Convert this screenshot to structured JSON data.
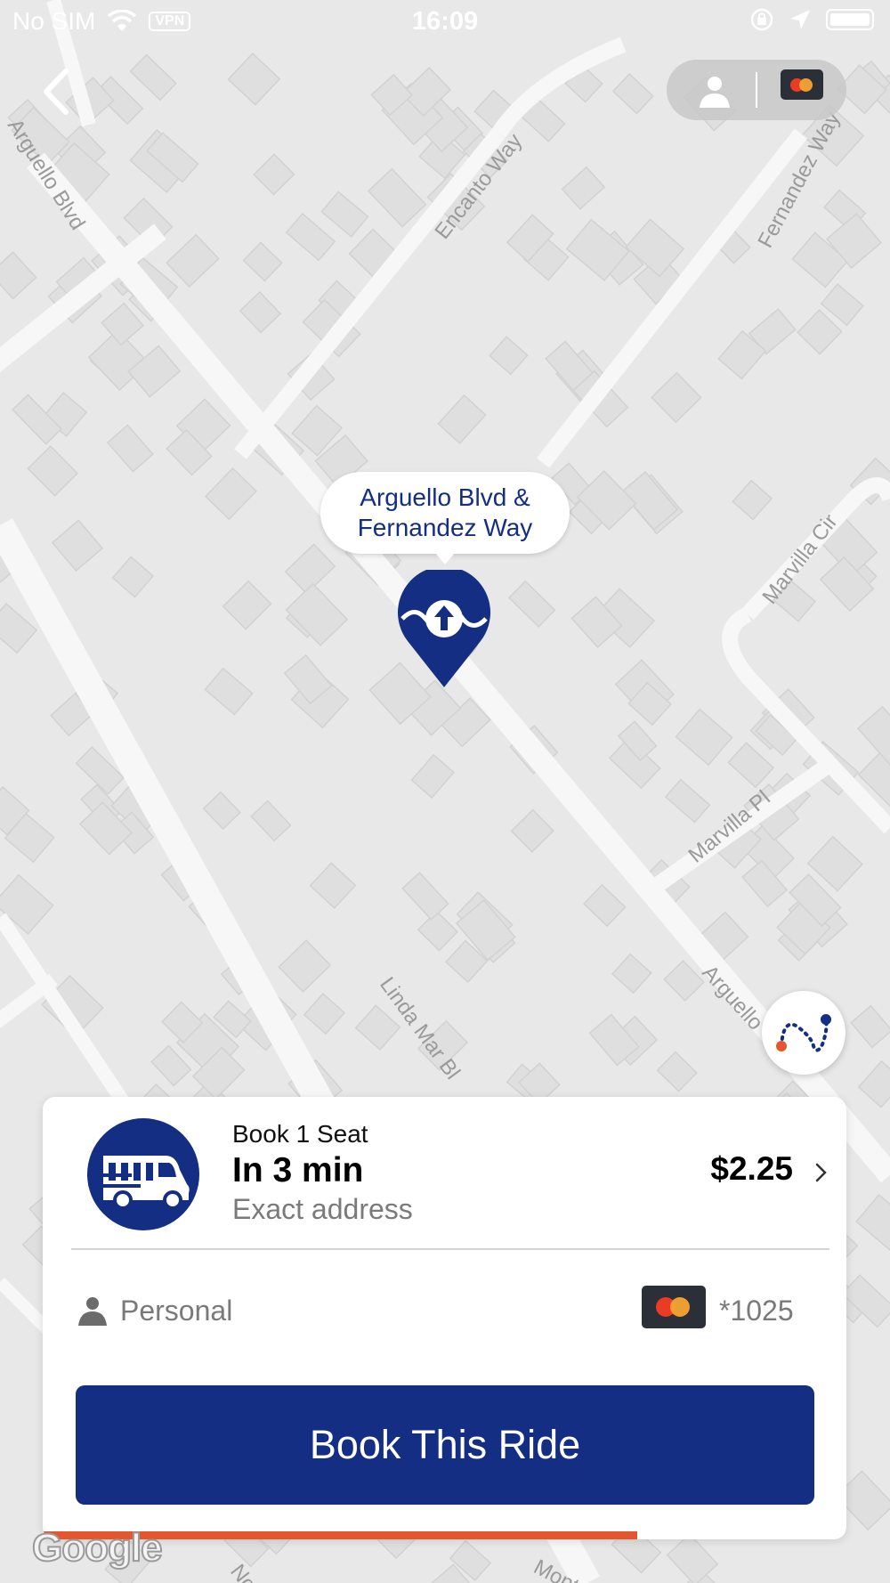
{
  "status_bar": {
    "carrier": "No SIM",
    "vpn": "VPN",
    "time": "16:09"
  },
  "map": {
    "streets": [
      {
        "name": "Arguello Blvd"
      },
      {
        "name": "Encanto Way"
      },
      {
        "name": "Fernandez Way"
      },
      {
        "name": "Marvilla Cir"
      },
      {
        "name": "Marvilla Pl"
      },
      {
        "name": "Linda Mar Bl"
      },
      {
        "name": "Arguello"
      },
      {
        "name": "Montezu"
      },
      {
        "name": "No"
      }
    ],
    "pickup_label_line1": "Arguello Blvd &",
    "pickup_label_line2": "Fernandez Way",
    "attribution": "Google"
  },
  "ride": {
    "seats": "Book 1 Seat",
    "eta": "In 3 min",
    "address_type": "Exact address",
    "price": "$2.25"
  },
  "profile": "Personal",
  "payment": {
    "last4": "*1025"
  },
  "book_button": "Book This Ride",
  "progress": 0.74,
  "colors": {
    "brand": "#132e82",
    "progress": "#e4572e",
    "map_bg": "#e9e9e9"
  }
}
